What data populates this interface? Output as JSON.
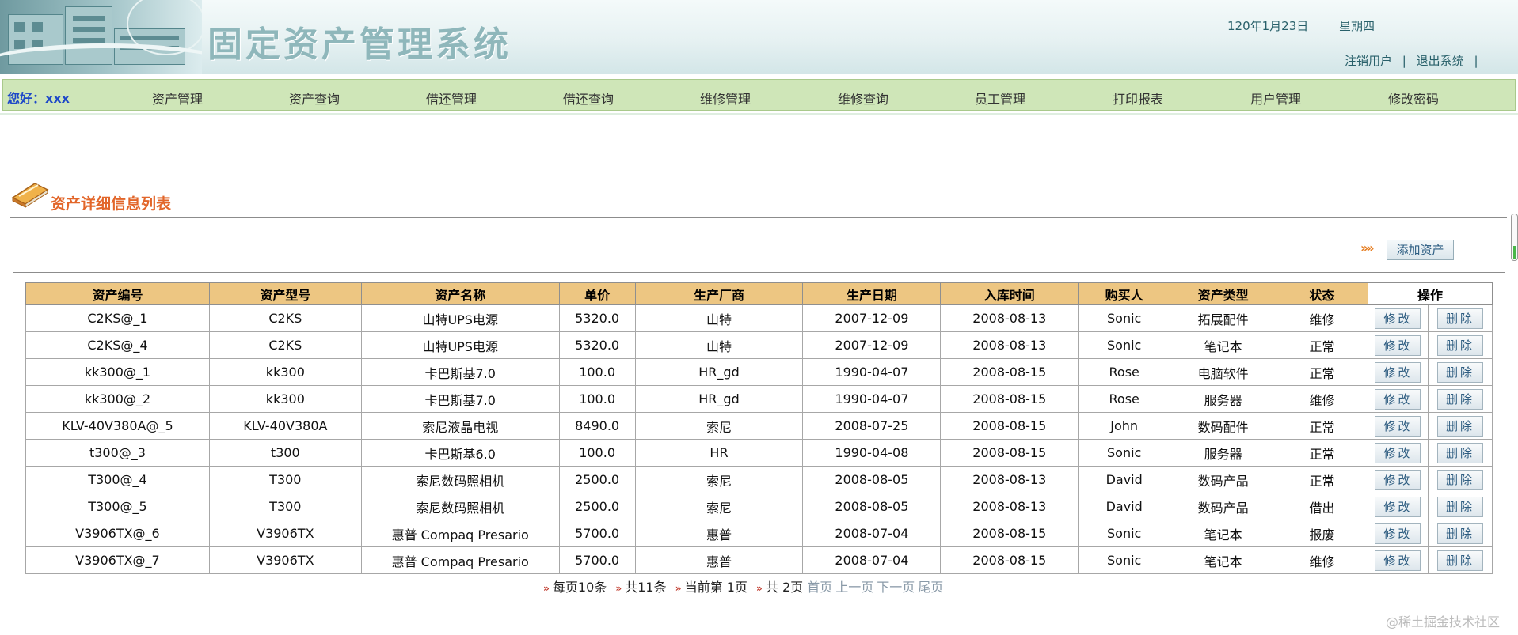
{
  "header": {
    "title": "固定资产管理系统",
    "date": "120年1月23日",
    "weekday": "星期四",
    "links": [
      "注销用户",
      "退出系统"
    ],
    "separator": "|"
  },
  "nav": {
    "greeting": "您好：xxx",
    "items": [
      "资产管理",
      "资产查询",
      "借还管理",
      "借还查询",
      "维修管理",
      "维修查询",
      "员工管理",
      "打印报表",
      "用户管理",
      "修改密码"
    ]
  },
  "section": {
    "title": "资产详细信息列表",
    "add_button": "添加资产"
  },
  "table": {
    "headers": [
      "资产编号",
      "资产型号",
      "资产名称",
      "单价",
      "生产厂商",
      "生产日期",
      "入库时间",
      "购买人",
      "资产类型",
      "状态",
      "操作"
    ],
    "edit_label": "修改",
    "delete_label": "删除",
    "rows": [
      [
        "C2KS@_1",
        "C2KS",
        "山特UPS电源",
        "5320.0",
        "山特",
        "2007-12-09",
        "2008-08-13",
        "Sonic",
        "拓展配件",
        "维修"
      ],
      [
        "C2KS@_4",
        "C2KS",
        "山特UPS电源",
        "5320.0",
        "山特",
        "2007-12-09",
        "2008-08-13",
        "Sonic",
        "笔记本",
        "正常"
      ],
      [
        "kk300@_1",
        "kk300",
        "卡巴斯基7.0",
        "100.0",
        "HR_gd",
        "1990-04-07",
        "2008-08-15",
        "Rose",
        "电脑软件",
        "正常"
      ],
      [
        "kk300@_2",
        "kk300",
        "卡巴斯基7.0",
        "100.0",
        "HR_gd",
        "1990-04-07",
        "2008-08-15",
        "Rose",
        "服务器",
        "维修"
      ],
      [
        "KLV-40V380A@_5",
        "KLV-40V380A",
        "索尼液晶电视",
        "8490.0",
        "索尼",
        "2008-07-25",
        "2008-08-15",
        "John",
        "数码配件",
        "正常"
      ],
      [
        "t300@_3",
        "t300",
        "卡巴斯基6.0",
        "100.0",
        "HR",
        "1990-04-08",
        "2008-08-15",
        "Sonic",
        "服务器",
        "正常"
      ],
      [
        "T300@_4",
        "T300",
        "索尼数码照相机",
        "2500.0",
        "索尼",
        "2008-08-05",
        "2008-08-13",
        "David",
        "数码产品",
        "正常"
      ],
      [
        "T300@_5",
        "T300",
        "索尼数码照相机",
        "2500.0",
        "索尼",
        "2008-08-05",
        "2008-08-13",
        "David",
        "数码产品",
        "借出"
      ],
      [
        "V3906TX@_6",
        "V3906TX",
        "惠普 Compaq Presario",
        "5700.0",
        "惠普",
        "2008-07-04",
        "2008-08-15",
        "Sonic",
        "笔记本",
        "报废"
      ],
      [
        "V3906TX@_7",
        "V3906TX",
        "惠普 Compaq Presario",
        "5700.0",
        "惠普",
        "2008-07-04",
        "2008-08-15",
        "Sonic",
        "笔记本",
        "维修"
      ]
    ]
  },
  "pagination": {
    "per_page": "每页10条",
    "total": "共11条",
    "current": "当前第 1页",
    "pages": "共 2页",
    "first": "首页",
    "prev": "上一页",
    "next": "下一页",
    "last": "尾页"
  },
  "watermark": "@稀土掘金技术社区",
  "colors": {
    "nav_bg": "#cfe6b8",
    "table_header_bg": "#edc682",
    "section_title": "#e2662a",
    "greeting": "#1f49c8"
  }
}
